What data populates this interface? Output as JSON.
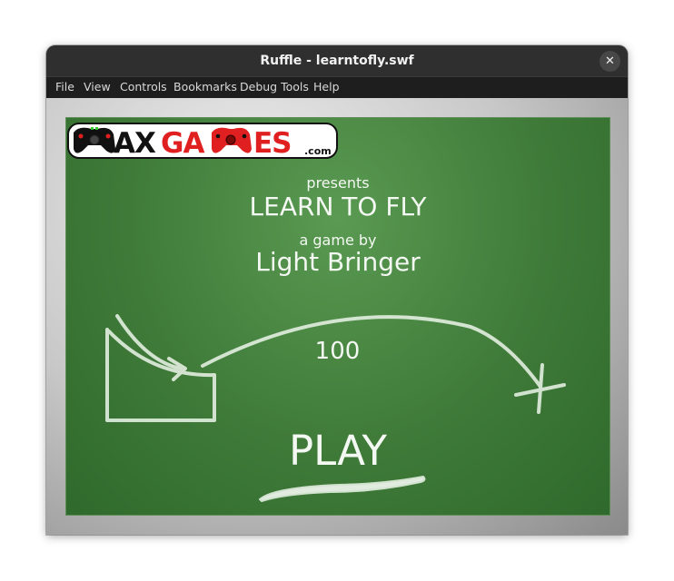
{
  "window": {
    "title": "Ruffle - learntofly.swf",
    "close_glyph": "✕"
  },
  "menu": {
    "items": [
      "File",
      "View",
      "Controls",
      "Bookmarks",
      "Debug Tools",
      "Help"
    ]
  },
  "game": {
    "logo_text": "MAXGAMES",
    "logo_suffix": ".com",
    "presents": "presents",
    "title": "LEARN TO FLY",
    "byline": "a game by",
    "author": "Light Bringer",
    "distance": "100",
    "play_label": "PLAY"
  },
  "colors": {
    "chalkboard": "#3f7a39",
    "chalk": "#f4f8f2",
    "logo_red": "#e02020",
    "logo_black": "#111111"
  }
}
